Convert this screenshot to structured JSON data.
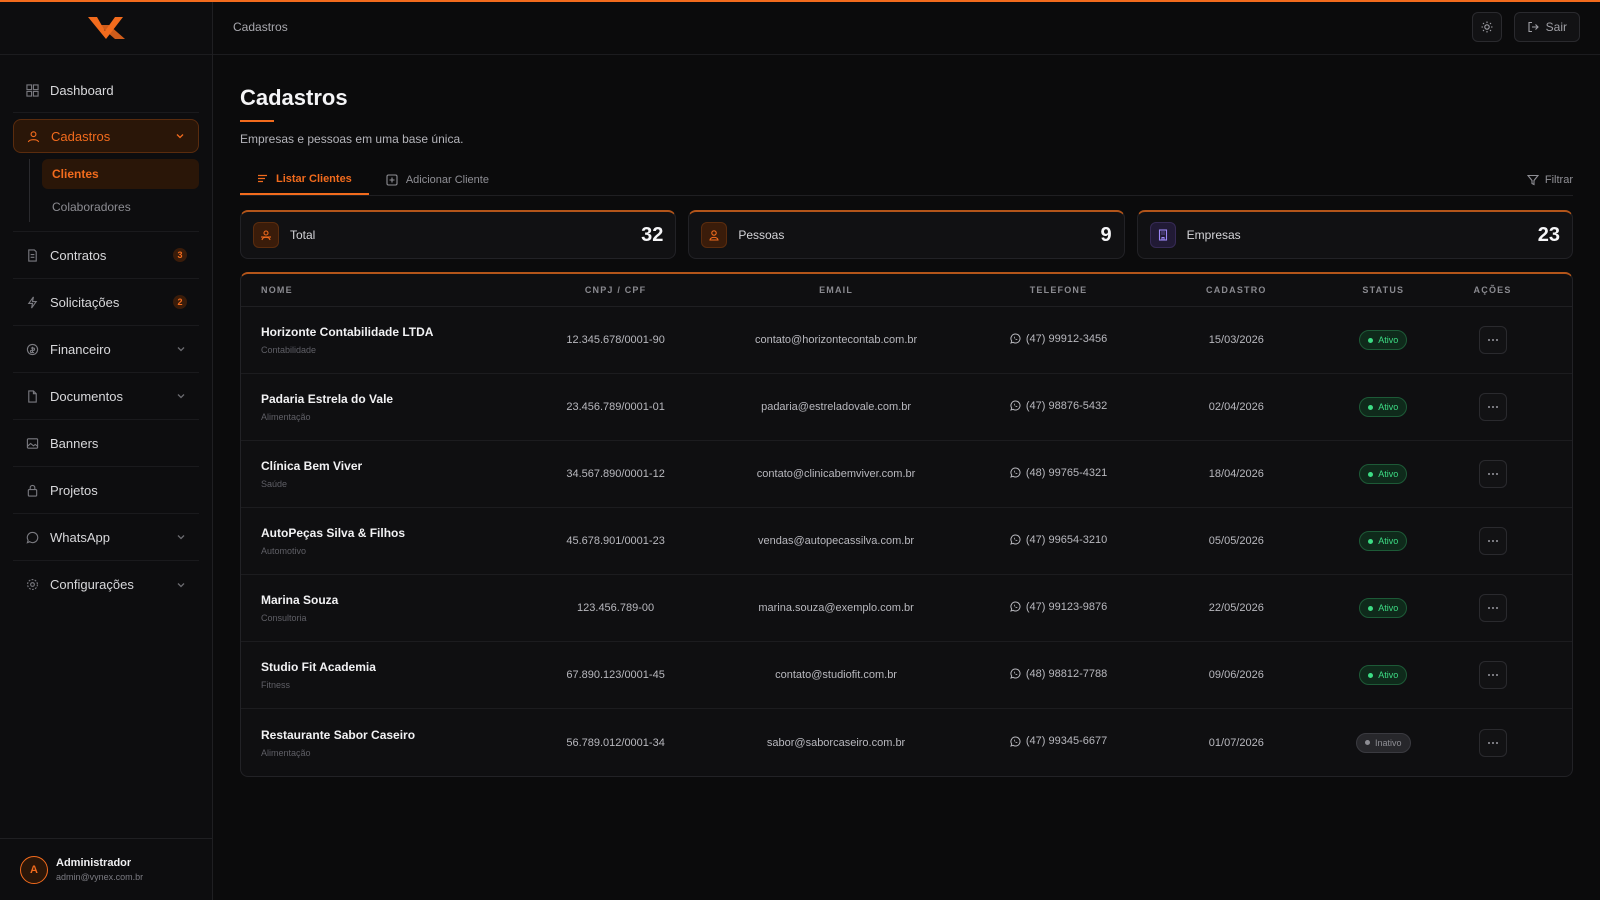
{
  "colors": {
    "accent": "#f26b1d",
    "success": "#3ddc84",
    "purple": "#9b87f5",
    "background": "#0b0b0c"
  },
  "header": {
    "breadcrumb": "Cadastros",
    "theme_icon": "sun-icon",
    "logout_label": "Sair"
  },
  "sidebar": {
    "items": [
      {
        "label": "Dashboard",
        "icon": "grid-icon"
      },
      {
        "label": "Cadastros",
        "icon": "user-icon",
        "active": true,
        "subitems": [
          {
            "label": "Clientes",
            "active": true
          },
          {
            "label": "Colaboradores"
          }
        ]
      },
      {
        "label": "Contratos",
        "icon": "file-icon",
        "badge": "3"
      },
      {
        "label": "Solicitações",
        "icon": "bolt-icon",
        "badge": "2"
      },
      {
        "label": "Financeiro",
        "icon": "coin-icon"
      },
      {
        "label": "Documentos",
        "icon": "document-icon"
      },
      {
        "label": "Banners",
        "icon": "image-icon"
      },
      {
        "label": "Projetos",
        "icon": "lock-icon"
      },
      {
        "label": "WhatsApp",
        "icon": "chat-icon"
      },
      {
        "label": "Configurações",
        "icon": "gear-icon"
      }
    ],
    "user": {
      "initial": "A",
      "name": "Administrador",
      "email": "admin@vynex.com.br"
    }
  },
  "main": {
    "title": "Cadastros",
    "subtitle": "Empresas e pessoas em uma base única.",
    "tabs": [
      {
        "label": "Listar Clientes",
        "active": true
      },
      {
        "label": "Adicionar Cliente"
      }
    ],
    "filter_label": "Filtrar",
    "stats": [
      {
        "label": "Total",
        "value": "32"
      },
      {
        "label": "Pessoas",
        "value": "9"
      },
      {
        "label": "Empresas",
        "value": "23"
      }
    ],
    "table": {
      "headers": [
        "NOME",
        "CNPJ / CPF",
        "EMAIL",
        "TELEFONE",
        "CADASTRO",
        "STATUS",
        "AÇÕES"
      ],
      "rows": [
        {
          "nome": "Horizonte Contabilidade LTDA",
          "categoria": "Contabilidade",
          "doc": "12.345.678/0001-90",
          "email": "contato@horizontecontab.com.br",
          "telefone": "(47) 99912-3456",
          "cadastro": "15/03/2026",
          "status": "Ativo"
        },
        {
          "nome": "Padaria Estrela do Vale",
          "categoria": "Alimentação",
          "doc": "23.456.789/0001-01",
          "email": "padaria@estreladovale.com.br",
          "telefone": "(47) 98876-5432",
          "cadastro": "02/04/2026",
          "status": "Ativo"
        },
        {
          "nome": "Clínica Bem Viver",
          "categoria": "Saúde",
          "doc": "34.567.890/0001-12",
          "email": "contato@clinicabemviver.com.br",
          "telefone": "(48) 99765-4321",
          "cadastro": "18/04/2026",
          "status": "Ativo"
        },
        {
          "nome": "AutoPeças Silva & Filhos",
          "categoria": "Automotivo",
          "doc": "45.678.901/0001-23",
          "email": "vendas@autopecassilva.com.br",
          "telefone": "(47) 99654-3210",
          "cadastro": "05/05/2026",
          "status": "Ativo"
        },
        {
          "nome": "Marina Souza",
          "categoria": "Consultoria",
          "doc": "123.456.789-00",
          "email": "marina.souza@exemplo.com.br",
          "telefone": "(47) 99123-9876",
          "cadastro": "22/05/2026",
          "status": "Ativo"
        },
        {
          "nome": "Studio Fit Academia",
          "categoria": "Fitness",
          "doc": "67.890.123/0001-45",
          "email": "contato@studiofit.com.br",
          "telefone": "(48) 98812-7788",
          "cadastro": "09/06/2026",
          "status": "Ativo"
        },
        {
          "nome": "Restaurante Sabor Caseiro",
          "categoria": "Alimentação",
          "doc": "56.789.012/0001-34",
          "email": "sabor@saborcaseiro.com.br",
          "telefone": "(47) 99345-6677",
          "cadastro": "01/07/2026",
          "status": "Inativo"
        }
      ],
      "row_action_icon": "more-horizontal-icon"
    }
  }
}
